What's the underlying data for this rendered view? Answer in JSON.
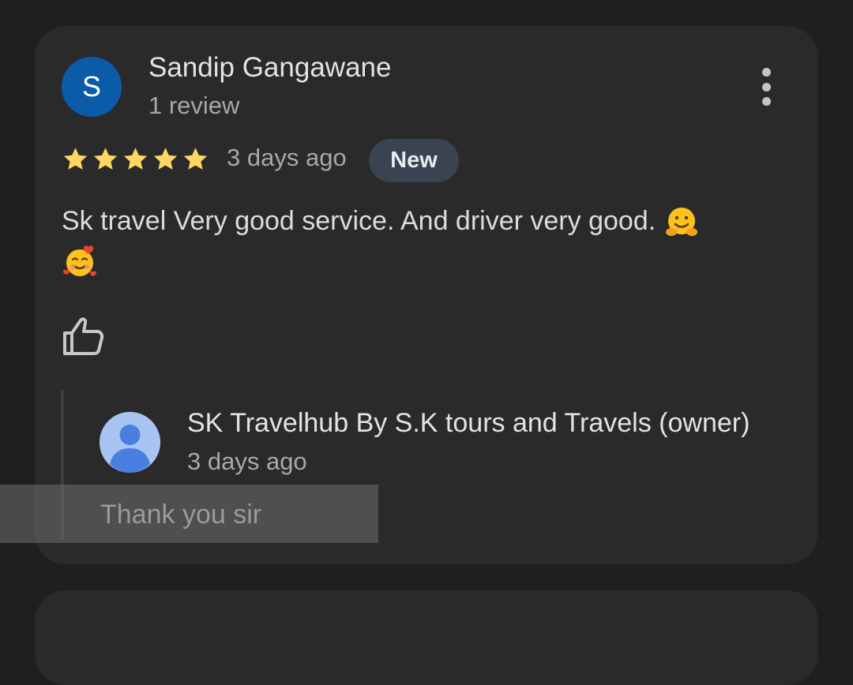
{
  "review": {
    "avatar_letter": "S",
    "avatar_color": "#0b5ca8",
    "reviewer_name": "Sandip Gangawane",
    "review_count": "1 review",
    "rating": 5,
    "rating_max": 5,
    "star_color": "#fdd663",
    "date": "3 days ago",
    "badge": "New",
    "text": "Sk travel Very good service. And driver very good.",
    "emojis": [
      "hugging-face-emoji",
      "smiling-face-with-hearts-emoji"
    ],
    "more_icon": "more-vertical-icon",
    "like_icon": "thumbs-up-icon"
  },
  "owner_reply": {
    "owner_name": "SK Travelhub By S.K tours and Travels (owner)",
    "date": "3 days ago",
    "text": "Thank you sir",
    "avatar_icon": "person-icon"
  }
}
